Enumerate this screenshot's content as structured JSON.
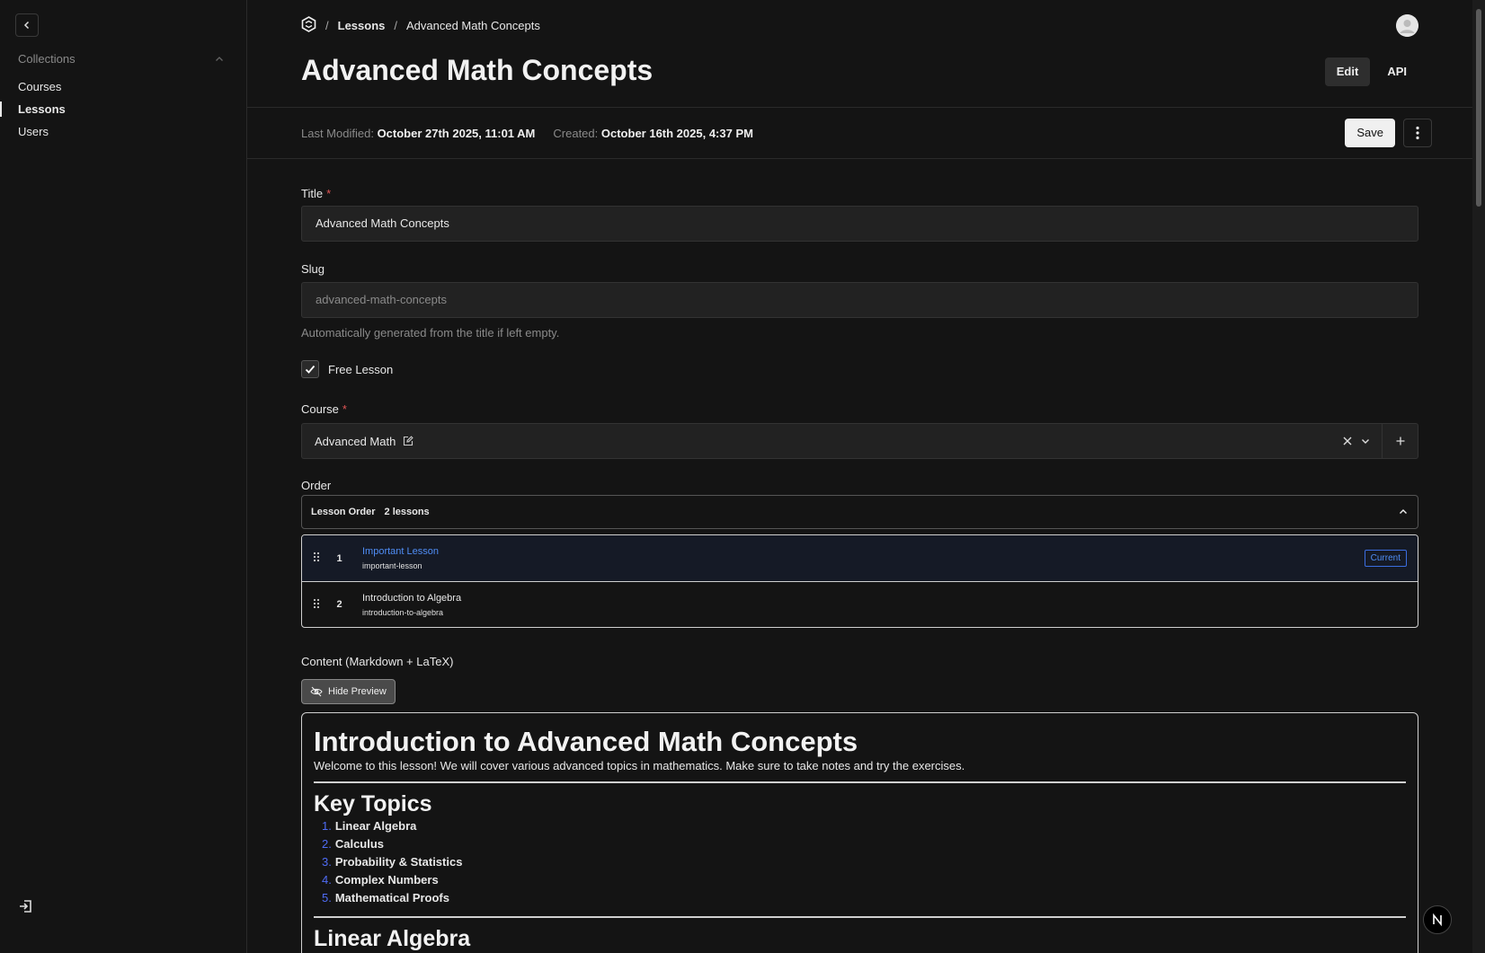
{
  "sidebar": {
    "collections_label": "Collections",
    "items": [
      {
        "label": "Courses"
      },
      {
        "label": "Lessons"
      },
      {
        "label": "Users"
      }
    ]
  },
  "breadcrumb": {
    "section": "Lessons",
    "current": "Advanced Math Concepts"
  },
  "header": {
    "title": "Advanced Math Concepts",
    "tabs": [
      {
        "label": "Edit"
      },
      {
        "label": "API"
      }
    ]
  },
  "meta": {
    "last_modified_label": "Last Modified:",
    "last_modified_value": "October 27th 2025, 11:01 AM",
    "created_label": "Created:",
    "created_value": "October 16th 2025, 4:37 PM",
    "save_label": "Save"
  },
  "form": {
    "title_label": "Title",
    "title_required": "*",
    "title_value": "Advanced Math Concepts",
    "slug_label": "Slug",
    "slug_value": "advanced-math-concepts",
    "slug_hint": "Automatically generated from the title if left empty.",
    "free_lesson_label": "Free Lesson",
    "free_lesson_checked": true,
    "course_label": "Course",
    "course_required": "*",
    "course_value": "Advanced Math",
    "order_label": "Order",
    "order_header": "Lesson Order",
    "order_count": "2 lessons",
    "lessons": [
      {
        "num": "1",
        "title": "Important Lesson",
        "slug": "important-lesson",
        "badge": "Current"
      },
      {
        "num": "2",
        "title": "Introduction to Algebra",
        "slug": "introduction-to-algebra"
      }
    ],
    "content_label": "Content (Markdown + LaTeX)",
    "hide_preview_label": "Hide Preview"
  },
  "preview": {
    "h1": "Introduction to Advanced Math Concepts",
    "intro": "Welcome to this lesson! We will cover various advanced topics in mathematics. Make sure to take notes and try the exercises.",
    "h2_topics": "Key Topics",
    "topics": [
      {
        "idx": "1.",
        "text": "Linear Algebra"
      },
      {
        "idx": "2.",
        "text": "Calculus"
      },
      {
        "idx": "3.",
        "text": "Probability & Statistics"
      },
      {
        "idx": "4.",
        "text": "Complex Numbers"
      },
      {
        "idx": "5.",
        "text": "Mathematical Proofs"
      }
    ],
    "h2_linear": "Linear Algebra"
  },
  "colors": {
    "background": "#141414",
    "accent_blue": "#4f8df5",
    "required_red": "#e05555"
  },
  "icons": [
    "chevron-left-icon",
    "chevron-up-icon",
    "logout-icon",
    "logo-icon",
    "avatar-icon",
    "kebab-menu-icon",
    "check-icon",
    "edit-icon",
    "clear-icon",
    "chevron-down-icon",
    "plus-icon",
    "drag-handle-icon",
    "eye-off-icon",
    "nextjs-icon"
  ]
}
